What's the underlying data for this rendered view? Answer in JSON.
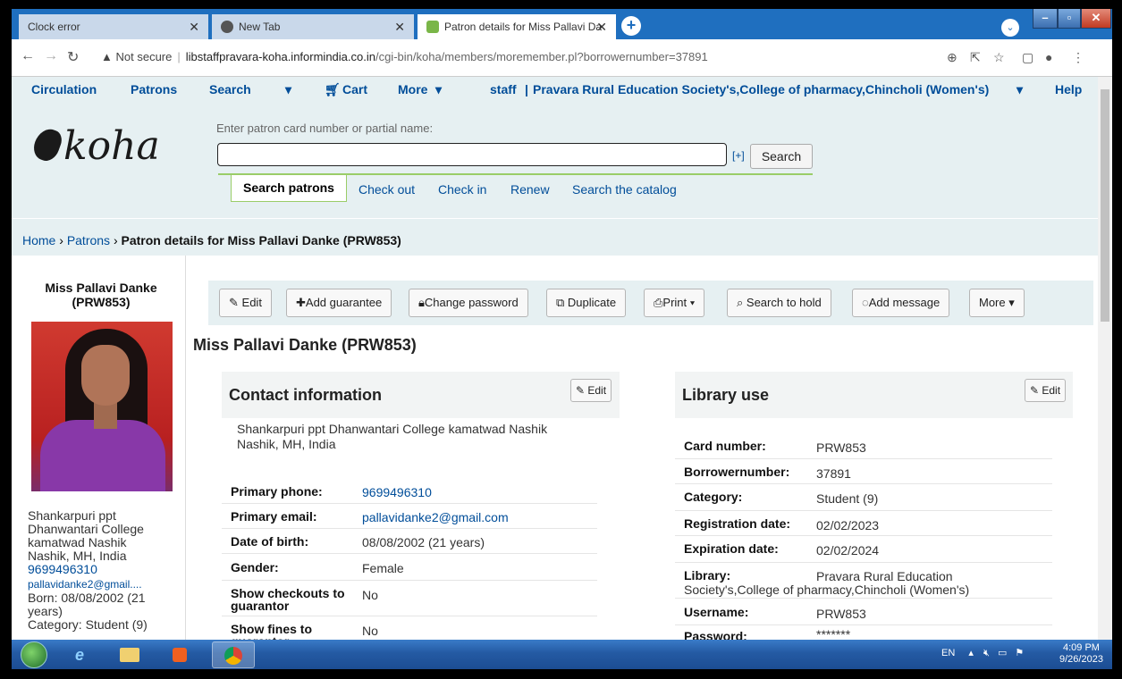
{
  "browser": {
    "tabs": [
      {
        "title": "Clock error",
        "active": false
      },
      {
        "title": "New Tab",
        "active": false
      },
      {
        "title": "Patron details for Miss Pallavi Da",
        "active": true
      }
    ],
    "security": "Not secure",
    "url_host": "libstaffpravara-koha.informindia.co.in",
    "url_path": "/cgi-bin/koha/members/moremember.pl?borrowernumber=37891"
  },
  "topnav": {
    "circulation": "Circulation",
    "patrons": "Patrons",
    "search": "Search",
    "cart": "Cart",
    "more": "More",
    "staff": "staff",
    "library": "Pravara Rural Education Society's,College of pharmacy,Chincholi (Women's)",
    "help": "Help"
  },
  "header": {
    "logo": "koha",
    "search_label": "Enter patron card number or partial name:",
    "search_value": "",
    "plus": "[+]",
    "search_button": "Search",
    "tabs": [
      "Search patrons",
      "Check out",
      "Check in",
      "Renew",
      "Search the catalog"
    ]
  },
  "breadcrumb": {
    "home": "Home",
    "patrons": "Patrons",
    "current": "Patron details for Miss Pallavi Danke (PRW853)"
  },
  "sidebar": {
    "name": "Miss Pallavi Danke",
    "card": "(PRW853)",
    "addr1": "Shankarpuri ppt",
    "addr2": "Dhanwantari College",
    "addr3": "kamatwad Nashik",
    "addr4": "Nashik, MH, India",
    "phone": "9699496310",
    "email": "pallavidanke2@gmail....",
    "born1": "Born: 08/08/2002 (21",
    "born2": "years)",
    "category": "Category: Student (9)"
  },
  "toolbar": {
    "edit": "Edit",
    "add_guarantee": "Add guarantee",
    "change_password": "Change password",
    "duplicate": "Duplicate",
    "print": "Print",
    "search_to_hold": "Search to hold",
    "add_message": "Add message",
    "more": "More"
  },
  "page_title": "Miss Pallavi Danke (PRW853)",
  "contact": {
    "heading": "Contact information",
    "edit": "Edit",
    "address1": "Shankarpuri ppt Dhanwantari College kamatwad Nashik",
    "address2": "Nashik, MH, India",
    "rows": [
      {
        "label": "Primary phone:",
        "value": "9699496310"
      },
      {
        "label": "Primary email:",
        "value": "pallavidanke2@gmail.com"
      },
      {
        "label": "Date of birth:",
        "value": "08/08/2002 (21 years)"
      },
      {
        "label": "Gender:",
        "value": "Female"
      },
      {
        "label": "Show checkouts to guarantor",
        "value": "No"
      },
      {
        "label": "Show fines to guarantor",
        "value": "No"
      }
    ]
  },
  "library_use": {
    "heading": "Library use",
    "edit": "Edit",
    "rows": [
      {
        "label": "Card number:",
        "value": "PRW853"
      },
      {
        "label": "Borrowernumber:",
        "value": "37891"
      },
      {
        "label": "Category:",
        "value": "Student (9)"
      },
      {
        "label": "Registration date:",
        "value": "02/02/2023"
      },
      {
        "label": "Expiration date:",
        "value": "02/02/2024"
      },
      {
        "label": "Library:",
        "value": "Pravara Rural Education"
      },
      {
        "label": "Username:",
        "value": "PRW853"
      },
      {
        "label": "Password:",
        "value": "*******"
      }
    ],
    "library_cont": "Society's,College of pharmacy,Chincholi (Women's)"
  },
  "taskbar": {
    "lang": "EN",
    "time": "4:09 PM",
    "date": "9/26/2023"
  }
}
